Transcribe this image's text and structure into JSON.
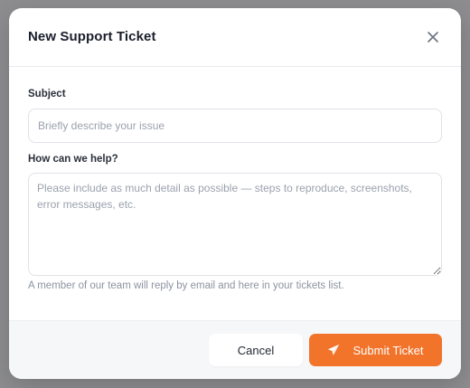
{
  "modal": {
    "title": "New Support Ticket",
    "close_icon": "close-icon"
  },
  "form": {
    "subject": {
      "label": "Subject",
      "value": "",
      "placeholder": "Briefly describe your issue"
    },
    "help": {
      "label": "How can we help?",
      "value": "",
      "placeholder": "Please include as much detail as possible — steps to reproduce, screenshots, error messages, etc."
    },
    "hint": "A member of our team will reply by email and here in your tickets list."
  },
  "footer": {
    "cancel_label": "Cancel",
    "submit_label": "Submit Ticket",
    "submit_icon": "paper-plane-icon"
  },
  "colors": {
    "accent": "#f2742b",
    "overlay": "#8e8e91"
  }
}
